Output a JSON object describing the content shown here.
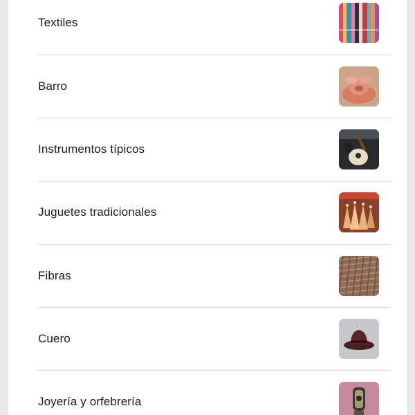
{
  "categories": [
    {
      "label": "Textiles",
      "thumbnail": "textiles-thumbnail"
    },
    {
      "label": "Barro",
      "thumbnail": "barro-thumbnail"
    },
    {
      "label": "Instrumentos típicos",
      "thumbnail": "instrumentos-thumbnail"
    },
    {
      "label": "Juguetes tradicionales",
      "thumbnail": "juguetes-thumbnail"
    },
    {
      "label": "Fibras",
      "thumbnail": "fibras-thumbnail"
    },
    {
      "label": "Cuero",
      "thumbnail": "cuero-thumbnail"
    },
    {
      "label": "Joyería y orfebrería",
      "thumbnail": "joyeria-thumbnail"
    }
  ],
  "colors": {
    "background": "#e9e9ea",
    "panel": "#ffffff",
    "text": "#1c1c1e",
    "divider": "#d8d8dc"
  }
}
